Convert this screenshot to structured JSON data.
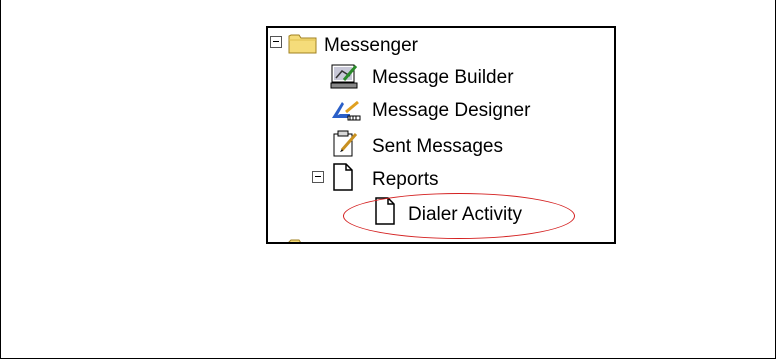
{
  "tree": {
    "root": {
      "label": "Messenger",
      "icon": "folder-icon",
      "expanded": true
    },
    "items": [
      {
        "label": "Message Builder",
        "icon": "message-builder-icon"
      },
      {
        "label": "Message Designer",
        "icon": "message-designer-icon"
      },
      {
        "label": "Sent Messages",
        "icon": "sent-messages-icon"
      }
    ],
    "reports": {
      "label": "Reports",
      "icon": "document-icon",
      "expanded": true,
      "children": [
        {
          "label": "Dialer Activity",
          "icon": "document-icon",
          "highlighted": true
        }
      ]
    }
  },
  "colors": {
    "folder": "#f5dc7a",
    "highlight": "#d42020",
    "border": "#000000"
  }
}
